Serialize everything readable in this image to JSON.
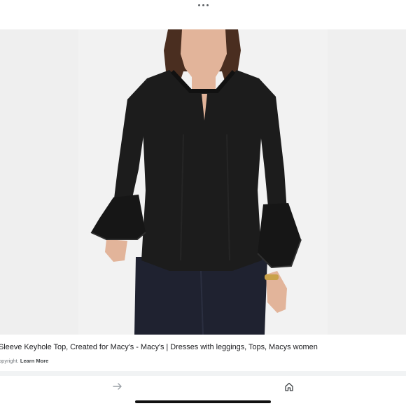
{
  "top_bar": {
    "more_icon": "more-horizontal-icon"
  },
  "image": {
    "subject": "product-photo-black-bell-sleeve-keyhole-top",
    "background": "#efefef",
    "garment_color": "#1c1c1c"
  },
  "caption": {
    "title": "Sleeve Keyhole Top, Created for Macy's - Macy's | Dresses with leggings, Tops, Macys women",
    "meta_prefix": "opyright.",
    "learn_more": "Learn More"
  },
  "bottom_bar": {
    "forward_icon": "arrow-right-icon",
    "home_icon": "home-icon"
  }
}
